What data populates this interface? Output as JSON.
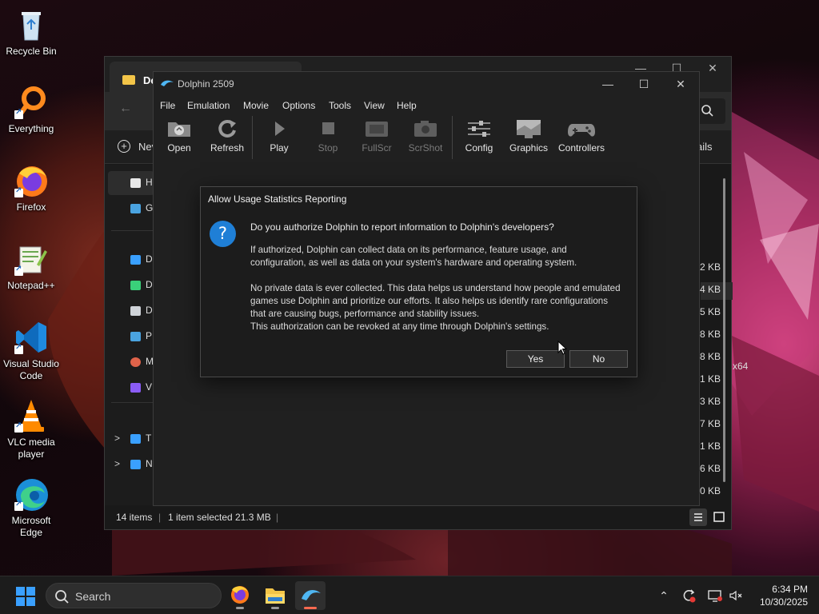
{
  "desktop": {
    "icons": [
      {
        "label": "Recycle Bin",
        "icon": "recycle-bin-icon"
      },
      {
        "label": "Everything",
        "icon": "search-magnifier-icon"
      },
      {
        "label": "Firefox",
        "icon": "firefox-icon"
      },
      {
        "label": "Notepad++",
        "icon": "notepad-plus-plus-icon"
      },
      {
        "label": "Visual Studio Code",
        "icon": "vscode-icon"
      },
      {
        "label": "VLC media player",
        "icon": "vlc-cone-icon"
      },
      {
        "label": "Microsoft Edge",
        "icon": "edge-icon"
      }
    ]
  },
  "explorer": {
    "tab_title": "Dol",
    "new_label": "Nev",
    "details_label": "ails",
    "sidebar": [
      {
        "label": "H",
        "icon": "home-icon",
        "color": "#e8e8e8"
      },
      {
        "label": "G",
        "icon": "gallery-icon",
        "color": "#4aa3e0"
      },
      {
        "label": "D",
        "icon": "desktop-icon",
        "color": "#3aa0ff"
      },
      {
        "label": "D",
        "icon": "downloads-icon",
        "color": "#3ad07a"
      },
      {
        "label": "D",
        "icon": "documents-icon",
        "color": "#cfd3d8"
      },
      {
        "label": "P",
        "icon": "pictures-icon",
        "color": "#4aa3e0"
      },
      {
        "label": "M",
        "icon": "music-icon",
        "color": "#e0634a"
      },
      {
        "label": "V",
        "icon": "videos-icon",
        "color": "#8b5cf6"
      },
      {
        "label": "T",
        "icon": "this-pc-icon",
        "color": "#3aa0ff"
      },
      {
        "label": "N",
        "icon": "network-icon",
        "color": "#3aa0ff"
      }
    ],
    "sizes": [
      "2 KB",
      "4 KB",
      "5 KB",
      "8 KB",
      "8 KB",
      "1 KB",
      "3 KB",
      "7 KB",
      "1 KB",
      "6 KB",
      "0 KB"
    ],
    "x64_fragment": "x64",
    "status": {
      "items": "14 items",
      "selected": "1 item selected  21.3 MB"
    }
  },
  "dolphin": {
    "title": "Dolphin 2509",
    "menu": [
      "File",
      "Emulation",
      "Movie",
      "Options",
      "Tools",
      "View",
      "Help"
    ],
    "toolbar": [
      {
        "label": "Open",
        "icon": "open-folder-icon",
        "enabled": true
      },
      {
        "label": "Refresh",
        "icon": "refresh-icon",
        "enabled": true
      },
      {
        "label": "Play",
        "icon": "play-icon",
        "enabled": true
      },
      {
        "label": "Stop",
        "icon": "stop-icon",
        "enabled": false
      },
      {
        "label": "FullScr",
        "icon": "fullscreen-icon",
        "enabled": false
      },
      {
        "label": "ScrShot",
        "icon": "screenshot-camera-icon",
        "enabled": false
      },
      {
        "label": "Config",
        "icon": "config-sliders-icon",
        "enabled": true
      },
      {
        "label": "Graphics",
        "icon": "graphics-monitor-icon",
        "enabled": true
      },
      {
        "label": "Controllers",
        "icon": "gamepad-icon",
        "enabled": true
      }
    ]
  },
  "dialog": {
    "title": "Allow Usage Statistics Reporting",
    "question": "Do you authorize Dolphin to report information to Dolphin's developers?",
    "para1_line1": "If authorized, Dolphin can collect data on its performance, feature usage, and",
    "para1_line2": "configuration, as well as data on your system's hardware and operating system.",
    "para2_line1": "No private data is ever collected. This data helps us understand how people and emulated",
    "para2_line2": "games use Dolphin and prioritize our efforts. It also helps us identify rare configurations",
    "para2_line3": "that are causing bugs, performance and stability issues.",
    "para2_line4": "This authorization can be revoked at any time through Dolphin's settings.",
    "yes_label": "Yes",
    "no_label": "No"
  },
  "taskbar": {
    "search_label": "Search",
    "apps": [
      {
        "name": "firefox",
        "icon": "firefox-icon",
        "active": false
      },
      {
        "name": "file-explorer",
        "icon": "file-explorer-icon",
        "active": false
      },
      {
        "name": "dolphin",
        "icon": "dolphin-icon",
        "active": true
      }
    ],
    "time": "6:34 PM",
    "date": "10/30/2025"
  },
  "colors": {
    "accent": "#1f7fd6",
    "active_indicator": "#ff6a50"
  }
}
